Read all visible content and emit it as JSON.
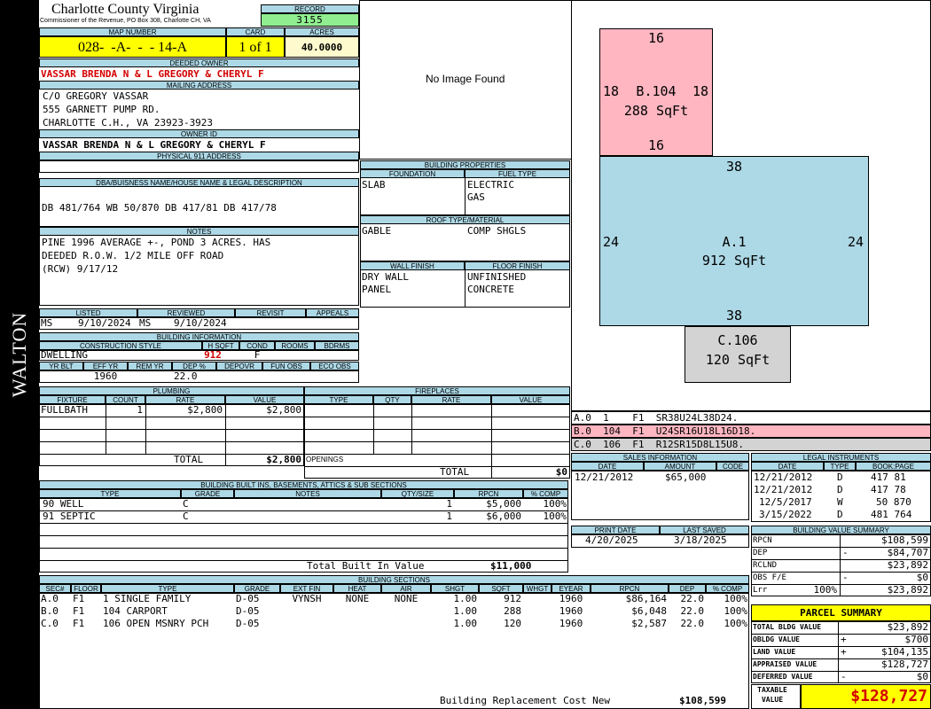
{
  "sidebar": {
    "label": "WALTON"
  },
  "county": {
    "name": "Charlotte County Virginia",
    "subtitle": "Commissioner of the Revenue, PO Box 308, Charlotte CH, VA"
  },
  "record": {
    "label": "RECORD",
    "value": "3155"
  },
  "map": {
    "label": "MAP NUMBER",
    "value": "028-  -A-  -  - 14-A"
  },
  "card": {
    "label": "CARD",
    "value": "1 of 1"
  },
  "acres": {
    "label": "ACRES",
    "value": "40.0000"
  },
  "deeded_owner": {
    "label": "DEEDED OWNER",
    "value": "VASSAR BRENDA N & L GREGORY & CHERYL F"
  },
  "mailing": {
    "label": "MAILING ADDRESS",
    "lines": [
      "C/O GREGORY VASSAR",
      "555 GARNETT PUMP RD.",
      "CHARLOTTE C.H., VA 23923-3923"
    ]
  },
  "owner_id": {
    "label": "OWNER ID",
    "value": "VASSAR BRENDA N & L GREGORY & CHERYL F"
  },
  "physical": {
    "label": "PHYSICAL 911 ADDRESS",
    "value": ""
  },
  "dba": {
    "label": "DBA/BUISNESS NAME/HOUSE NAME & LEGAL DESCRIPTION",
    "value": "DB 481/764 WB 50/870 DB 417/81 DB 417/78"
  },
  "notes": {
    "label": "NOTES",
    "lines": [
      "PINE 1996 AVERAGE +-, POND 3 ACRES. HAS",
      "DEEDED R.O.W. 1/2 MILE OFF ROAD",
      "(RCW) 9/17/12"
    ]
  },
  "no_image": "No Image Found",
  "building_properties": {
    "label": "BUILDING PROPERTIES",
    "foundation_label": "FOUNDATION",
    "foundation": "SLAB",
    "fuel_label": "FUEL TYPE",
    "fuel": [
      "ELECTRIC",
      "GAS"
    ],
    "roof_label": "ROOF TYPE/MATERIAL",
    "roof_type": "GABLE",
    "roof_material": "COMP SHGLS",
    "wall_label": "WALL FINISH",
    "wall": [
      "DRY WALL",
      "PANEL"
    ],
    "floor_label": "FLOOR FINISH",
    "floor": [
      "UNFINISHED",
      "CONCRETE"
    ]
  },
  "status": {
    "listed_label": "LISTED",
    "listed_prefix": "MS",
    "listed": "9/10/2024",
    "reviewed_label": "REVIEWED",
    "reviewed_prefix": "MS",
    "reviewed": "9/10/2024",
    "revisit_label": "REVISIT",
    "appeals_label": "APPEALS"
  },
  "building_info": {
    "label": "BUILDING INFORMATION",
    "cols": [
      "CONSTRUCTION STYLE",
      "H SQFT",
      "COND",
      "ROOMS",
      "BDRMS"
    ],
    "style": "DWELLING",
    "hsqft": "912",
    "cond": "F",
    "cols2": [
      "YR BLT",
      "EFF YR",
      "REM YR",
      "DEP %",
      "DEPOVR",
      "FUN OBS",
      "ECO OBS"
    ],
    "eff_yr": "1960",
    "dep": "22.0"
  },
  "plumbing": {
    "label": "PLUMBING",
    "cols": [
      "FIXTURE",
      "COUNT",
      "RATE",
      "VALUE"
    ],
    "rows": [
      {
        "fixture": "FULLBATH",
        "count": "1",
        "rate": "$2,800",
        "value": "$2,800"
      }
    ],
    "total_label": "TOTAL",
    "total": "$2,800"
  },
  "fireplaces": {
    "label": "FIREPLACES",
    "cols": [
      "TYPE",
      "QTY",
      "RATE",
      "VALUE"
    ],
    "openings_label": "OPENINGS",
    "total_label": "TOTAL",
    "total": "$0"
  },
  "sketch": {
    "areas": [
      {
        "label": "B.104",
        "sqft": "288 SqFt",
        "top": "16",
        "bottom": "16",
        "left": "18",
        "right": "18",
        "color": "#ffb6c1"
      },
      {
        "label": "A.1",
        "sqft": "912 SqFt",
        "top": "38",
        "bottom": "38",
        "left": "24",
        "right": "24",
        "color": "#add8e6"
      },
      {
        "label": "C.106",
        "sqft": "120 SqFt",
        "color": "#d3d3d3"
      }
    ],
    "codes": [
      {
        "text": "A.0  1    F1  SR38U24L38D24.",
        "color": "#ffffff"
      },
      {
        "text": "B.0  104  F1  U24SR16U18L16D18.",
        "color": "#ffb6c1"
      },
      {
        "text": "C.0  106  F1  R12SR15D8L15U8.",
        "color": "#d3d3d3"
      }
    ]
  },
  "sales": {
    "label": "SALES INFORMATION",
    "cols": [
      "DATE",
      "AMOUNT",
      "CODE"
    ],
    "rows": [
      {
        "date": "12/21/2012",
        "amount": "$65,000",
        "code": ""
      }
    ]
  },
  "legal": {
    "label": "LEGAL INSTRUMENTS",
    "cols": [
      "DATE",
      "TYPE",
      "BOOK:PAGE"
    ],
    "rows": [
      {
        "date": "12/21/2012",
        "type": "D",
        "book": "417 81"
      },
      {
        "date": "12/21/2012",
        "type": "D",
        "book": "417 78"
      },
      {
        "date": "12/5/2017",
        "type": "W",
        "book": "50 870"
      },
      {
        "date": "3/15/2022",
        "type": "D",
        "book": "481 764"
      }
    ]
  },
  "print": {
    "print_label": "PRINT DATE",
    "print_date": "4/20/2025",
    "saved_label": "LAST SAVED",
    "saved_date": "3/18/2025"
  },
  "builtins": {
    "label": "BUILDING BUILT INS, BASEMENTS, ATTICS & SUB SECTIONS",
    "cols": [
      "TYPE",
      "GRADE",
      "NOTES",
      "QTY/SIZE",
      "RPCN",
      "% COMP"
    ],
    "rows": [
      {
        "type": "90 WELL",
        "grade": "C",
        "notes": "",
        "qty": "1",
        "rpcn": "$5,000",
        "comp": "100%"
      },
      {
        "type": "91 SEPTIC",
        "grade": "C",
        "notes": "",
        "qty": "1",
        "rpcn": "$6,000",
        "comp": "100%"
      }
    ],
    "total_label": "Total Built In Value",
    "total": "$11,000"
  },
  "value_summary": {
    "label": "BUILDING VALUE SUMMARY",
    "rows": [
      {
        "label": "RPCN",
        "sign": "",
        "pct": "",
        "value": "$108,599"
      },
      {
        "label": "DEP",
        "sign": "-",
        "pct": "",
        "value": "$84,707"
      },
      {
        "label": "RCLND",
        "sign": "",
        "pct": "",
        "value": "$23,892"
      },
      {
        "label": "OBS F/E",
        "sign": "-",
        "pct": "",
        "value": "$0"
      },
      {
        "label": "Lrr",
        "sign": "",
        "pct": "100%",
        "value": "$23,892"
      }
    ]
  },
  "sections": {
    "label": "BUILDING SECTIONS",
    "cols": [
      "SEC#",
      "FLOOR",
      "TYPE",
      "GRADE",
      "EXT FIN",
      "HEAT",
      "AIR",
      "SHGT",
      "SQFT",
      "WHGT",
      "EYEAR",
      "RPCN",
      "DEP",
      "% COMP"
    ],
    "rows": [
      {
        "sec": "A.0",
        "floor": "F1",
        "type": "1 SINGLE FAMILY",
        "grade": "D-05",
        "ext": "VYNSH",
        "heat": "NONE",
        "air": "NONE",
        "shgt": "1.00",
        "sqft": "912",
        "whgt": "",
        "eyear": "1960",
        "rpcn": "$86,164",
        "dep": "22.0",
        "comp": "100%"
      },
      {
        "sec": "B.0",
        "floor": "F1",
        "type": "104 CARPORT",
        "grade": "D-05",
        "ext": "",
        "heat": "",
        "air": "",
        "shgt": "1.00",
        "sqft": "288",
        "whgt": "",
        "eyear": "1960",
        "rpcn": "$6,048",
        "dep": "22.0",
        "comp": "100%"
      },
      {
        "sec": "C.0",
        "floor": "F1",
        "type": "106 OPEN MSNRY PCH",
        "grade": "D-05",
        "ext": "",
        "heat": "",
        "air": "",
        "shgt": "1.00",
        "sqft": "120",
        "whgt": "",
        "eyear": "1960",
        "rpcn": "$2,587",
        "dep": "22.0",
        "comp": "100%"
      }
    ],
    "replacement_label": "Building Replacement Cost New",
    "replacement": "$108,599"
  },
  "parcel": {
    "label": "PARCEL SUMMARY",
    "rows": [
      {
        "label": "TOTAL BLDG VALUE",
        "sign": "",
        "value": "$23,892"
      },
      {
        "label": "OBLDG VALUE",
        "sign": "+",
        "value": "$700"
      },
      {
        "label": "LAND VALUE",
        "sign": "+",
        "value": "$104,135"
      },
      {
        "label": "APPRAISED VALUE",
        "sign": "",
        "value": "$128,727"
      },
      {
        "label": "DEFERRED VALUE",
        "sign": "-",
        "value": "$0"
      }
    ],
    "taxable_label": "TAXABLE VALUE",
    "taxable": "$128,727"
  }
}
